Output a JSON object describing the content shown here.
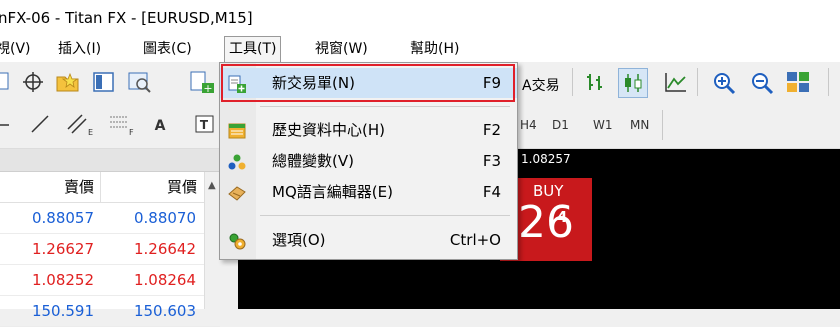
{
  "window": {
    "title": "nFX-06 - Titan FX - [EURUSD,M15]"
  },
  "menubar": {
    "items": [
      {
        "label": "視(V)"
      },
      {
        "label": "插入(I)"
      },
      {
        "label": "圖表(C)"
      },
      {
        "label": "工具(T)"
      },
      {
        "label": "視窗(W)"
      },
      {
        "label": "幫助(H)"
      }
    ]
  },
  "toolbar": {
    "trade_label": "A交易",
    "timeframes": [
      "H4",
      "D1",
      "W1",
      "MN"
    ]
  },
  "tools_menu": {
    "items": [
      {
        "label": "新交易單(N)",
        "shortcut": "F9",
        "icon": "new-order-icon"
      },
      {
        "label": "歷史資料中心(H)",
        "shortcut": "F2",
        "icon": "history-center-icon"
      },
      {
        "label": "總體變數(V)",
        "shortcut": "F3",
        "icon": "global-variables-icon"
      },
      {
        "label": "MQ語言編輯器(E)",
        "shortcut": "F4",
        "icon": "metaeditor-icon"
      },
      {
        "label": "選項(O)",
        "shortcut": "Ctrl+O",
        "icon": "options-icon"
      }
    ]
  },
  "market_watch": {
    "columns": {
      "bid": "賣價",
      "ask": "買價"
    },
    "rows": [
      {
        "bid": "0.88057",
        "ask": "0.88070",
        "bid_color": "#1a5fd6",
        "ask_color": "#1a5fd6"
      },
      {
        "bid": "1.26627",
        "ask": "1.26642",
        "bid_color": "#e02020",
        "ask_color": "#e02020"
      },
      {
        "bid": "1.08252",
        "ask": "1.08264",
        "bid_color": "#e02020",
        "ask_color": "#e02020"
      },
      {
        "bid": "150.591",
        "ask": "150.603",
        "bid_color": "#1a5fd6",
        "ask_color": "#1a5fd6"
      }
    ]
  },
  "chart": {
    "info_text": "1.08257",
    "buy_label": "BUY",
    "buy_price_big": "26",
    "buy_price_sup": "4"
  },
  "colors": {
    "highlight_border": "#e0202a",
    "buy_red": "#c8191c",
    "menu_highlight": "#cfe3f7"
  }
}
